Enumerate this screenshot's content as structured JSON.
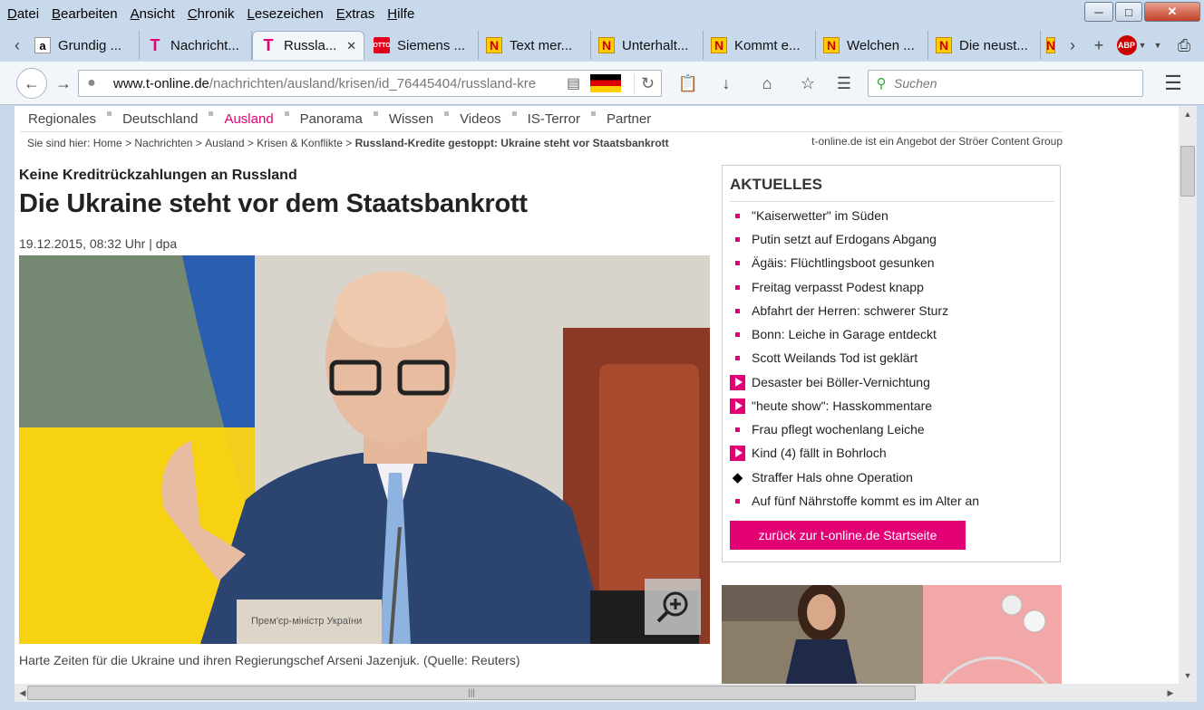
{
  "menu": [
    "Datei",
    "Bearbeiten",
    "Ansicht",
    "Chronik",
    "Lesezeichen",
    "Extras",
    "Hilfe"
  ],
  "tabs": [
    {
      "label": "Grundig ...",
      "icon": "amazon-icon"
    },
    {
      "label": "Nachricht...",
      "icon": "telekom-icon"
    },
    {
      "label": "Russla...",
      "icon": "telekom-icon",
      "active": true
    },
    {
      "label": "Siemens ...",
      "icon": "otto-icon"
    },
    {
      "label": "Text mer...",
      "icon": "n-icon"
    },
    {
      "label": "Unterhalt...",
      "icon": "n-icon"
    },
    {
      "label": "Kommt e...",
      "icon": "n-icon"
    },
    {
      "label": "Welchen ...",
      "icon": "n-icon"
    },
    {
      "label": "Die neust...",
      "icon": "n-icon"
    }
  ],
  "url": {
    "host": "www.t-online.de",
    "path": "/nachrichten/ausland/krisen/id_76445404/russland-kre"
  },
  "search": {
    "placeholder": "Suchen"
  },
  "site_nav": [
    "Regionales",
    "Deutschland",
    "Ausland",
    "Panorama",
    "Wissen",
    "Videos",
    "IS-Terror",
    "Partner"
  ],
  "breadcrumb": {
    "prefix": "Sie sind hier:",
    "items": [
      "Home",
      "Nachrichten",
      "Ausland",
      "Krisen & Konflikte"
    ],
    "current": "Russland-Kredite gestoppt: Ukraine steht vor Staatsbankrott",
    "provider": "t-online.de ist ein Angebot der Ströer Content Group"
  },
  "article": {
    "kicker": "Keine Kreditrückzahlungen an Russland",
    "headline": "Die Ukraine steht vor dem Staatsbankrott",
    "dateline": "19.12.2015, 08:32 Uhr | dpa",
    "caption": "Harte Zeiten für die Ukraine und ihren Regierungschef Arseni Jazenjuk. (Quelle: Reuters)",
    "nameplate": "Прем'єр-міністр України"
  },
  "aktuelles": {
    "title": "AKTUELLES",
    "items": [
      {
        "text": "\"Kaiserwetter\" im Süden",
        "type": "bullet"
      },
      {
        "text": "Putin setzt auf Erdogans Abgang",
        "type": "bullet"
      },
      {
        "text": "Ägäis: Flüchtlingsboot gesunken",
        "type": "bullet"
      },
      {
        "text": "Freitag verpasst Podest knapp",
        "type": "bullet"
      },
      {
        "text": "Abfahrt der Herren: schwerer Sturz",
        "type": "bullet"
      },
      {
        "text": "Bonn: Leiche in Garage entdeckt",
        "type": "bullet"
      },
      {
        "text": "Scott Weilands Tod ist geklärt",
        "type": "bullet"
      },
      {
        "text": "Desaster bei Böller-Vernichtung",
        "type": "video"
      },
      {
        "text": "\"heute show\": Hasskommentare",
        "type": "video"
      },
      {
        "text": "Frau pflegt wochenlang Leiche",
        "type": "bullet"
      },
      {
        "text": "Kind (4) fällt in Bohrloch",
        "type": "video"
      },
      {
        "text": "Straffer Hals ohne Operation",
        "type": "diamond"
      },
      {
        "text": "Auf fünf Nährstoffe kommt es im Alter an",
        "type": "bullet"
      }
    ],
    "back_button": "zurück zur t-online.de Startseite"
  },
  "colors": {
    "brand": "#e20074"
  }
}
